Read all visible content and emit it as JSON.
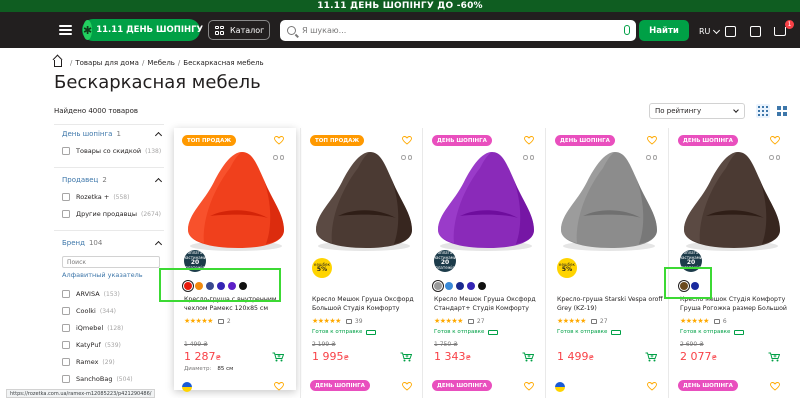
{
  "promo": {
    "text": "11.11 ДЕНЬ ШОПІНГУ ДО -60%"
  },
  "header": {
    "logo_text": "11.11 ДЕНЬ ШОПІНГУ",
    "catalog_label": "Каталог",
    "search_placeholder": "Я шукаю...",
    "find_label": "Найти",
    "lang": "RU",
    "cart_count": "1",
    "icons": [
      "menu-icon",
      "catalog-grid-icon",
      "search-icon",
      "microphone-icon",
      "chevron-down-icon",
      "notifications-icon",
      "orders-icon",
      "cart-icon"
    ]
  },
  "breadcrumb": [
    "Товары для дома",
    "Мебель",
    "Бескаркасная мебель"
  ],
  "page_title": "Бескаркасная мебель",
  "found_text": "Найдено 4000 товаров",
  "sort": {
    "selected": "По рейтингу"
  },
  "filters": {
    "groups": [
      {
        "title": "День шопінга",
        "count": "1",
        "items": [
          {
            "label": "Товары со скидкой",
            "count": "(138)"
          }
        ]
      },
      {
        "title": "Продавец",
        "count": "2",
        "items": [
          {
            "label": "Rozetka +",
            "count": "(558)"
          },
          {
            "label": "Другие продавцы",
            "count": "(2674)"
          }
        ]
      },
      {
        "title": "Бренд",
        "count": "104",
        "search_placeholder": "Поиск",
        "alphabet_link": "Алфавитный указатель",
        "items": [
          {
            "label": "ARVISA",
            "count": "(153)"
          },
          {
            "label": "Coolki",
            "count": "(344)"
          },
          {
            "label": "iQmebel",
            "count": "(128)"
          },
          {
            "label": "KatyPuf",
            "count": "(539)"
          },
          {
            "label": "Ramex",
            "count": "(29)"
          },
          {
            "label": "SanchoBag",
            "count": "(504)"
          }
        ]
      }
    ]
  },
  "products": [
    {
      "badge": "ТОП ПРОДАЖ",
      "badge_type": "top",
      "color": "#f0401c",
      "sticker": {
        "kind": "dark",
        "line1": "оплата частинами",
        "big": "20",
        "line2": "платежів"
      },
      "swatches": [
        "#e8190c",
        "#f28a0e",
        "#3a4a8e",
        "#3525b5",
        "#5c1fc7",
        "#111111"
      ],
      "title": "Кресло-груша с внутренним чехлом Рамекс 120х85 см",
      "reviews": "2",
      "ready": "",
      "old_price": "1 499 ₴",
      "price": "1 287",
      "currency": "₴",
      "extra_label": "Диаметр:",
      "extra_value": "85 см"
    },
    {
      "badge": "ТОП ПРОДАЖ",
      "badge_type": "top",
      "color": "#4b3a33",
      "sticker": {
        "kind": "yellow",
        "line1": "кешбек",
        "big": "5%",
        "line2": ""
      },
      "swatches": [],
      "title": "Кресло Мешок Груша Оксфорд Большой Студія Комфорту",
      "reviews": "39",
      "ready": "Готов к отправке",
      "old_price": "2 199 ₴",
      "price": "1 995",
      "currency": "₴",
      "extra_label": "",
      "extra_value": ""
    },
    {
      "badge": "ДЕНЬ ШОПІНГА",
      "badge_type": "day",
      "color": "#8a2ab9",
      "sticker": {
        "kind": "dark",
        "line1": "оплата частинами",
        "big": "20",
        "line2": "платежів"
      },
      "swatches": [
        "#9a9a9a",
        "#3a8ad8",
        "#1a2a8e",
        "#3525b5",
        "#111111"
      ],
      "title": "Кресло Мешок Груша Оксфорд Стандарт+ Студія Комфорту",
      "reviews": "27",
      "ready": "Готов к отправке",
      "old_price": "1 750 ₴",
      "price": "1 343",
      "currency": "₴",
      "extra_label": "",
      "extra_value": ""
    },
    {
      "badge": "ДЕНЬ ШОПІНГА",
      "badge_type": "day",
      "color": "#8c8c8c",
      "sticker": {
        "kind": "yellow",
        "line1": "кешбек",
        "big": "5%",
        "line2": ""
      },
      "swatches": [],
      "title": "Кресло-груша Starski Vespa oroff Grey (KZ-19)",
      "reviews": "27",
      "ready": "Готов к отправке",
      "old_price": "",
      "price": "1 499",
      "currency": "₴",
      "extra_label": "",
      "extra_value": ""
    },
    {
      "badge": "ДЕНЬ ШОПІНГА",
      "badge_type": "day",
      "color": "#4b3a33",
      "sticker": {
        "kind": "dark",
        "line1": "оплата частинами",
        "big": "20",
        "line2": "платежів"
      },
      "swatches": [
        "#6b4a1e",
        "#1a2a9e"
      ],
      "title": "Кресло мешок Студія Комфорту Груша Рогожка размер Большой",
      "reviews": "6",
      "ready": "Готов к отправке",
      "old_price": "2 690 ₴",
      "price": "2 077",
      "currency": "₴",
      "extra_label": "",
      "extra_value": ""
    }
  ],
  "bottom_badges": [
    "",
    "ДЕНЬ ШОПІНГА",
    "ДЕНЬ ШОПІНГА",
    "",
    "ДЕНЬ ШОПІНГА"
  ],
  "status_url": "https://rozetka.com.ua/ramex-m12085223/p421290486/",
  "colors": {
    "accent_green": "#00a046",
    "header_bg": "#221f1f",
    "price_red": "#f84147",
    "link_blue": "#3e77aa",
    "badge_top": "#ff9900",
    "badge_day": "#e94fbe",
    "highlight_box": "#3cd934"
  }
}
